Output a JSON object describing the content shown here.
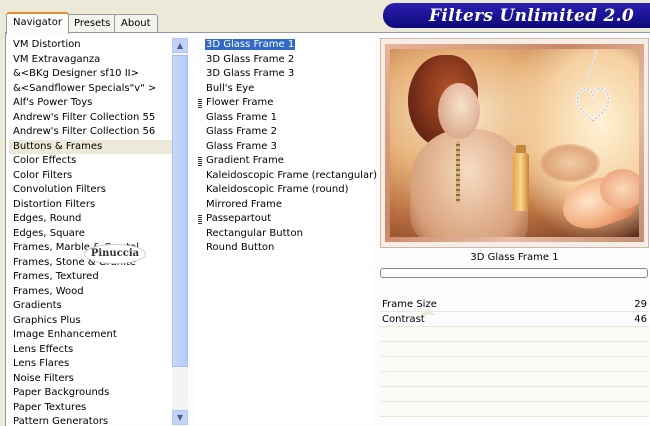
{
  "app_title": "Filters Unlimited 2.0",
  "tabs": [
    {
      "label": "Navigator",
      "active": true
    },
    {
      "label": "Presets",
      "active": false
    },
    {
      "label": "About",
      "active": false
    }
  ],
  "categories": [
    "VM Distortion",
    "VM Extravaganza",
    "&<BKg Designer sf10 II>",
    "&<Sandflower Specials\"v\" >",
    "Alf's Power Toys",
    "Andrew's Filter Collection 55",
    "Andrew's Filter Collection 56",
    "Buttons & Frames",
    "Color Effects",
    "Color Filters",
    "Convolution Filters",
    "Distortion Filters",
    "Edges, Round",
    "Edges, Square",
    "Frames, Marble & Crystal",
    "Frames, Stone & Granite",
    "Frames, Textured",
    "Frames, Wood",
    "Gradients",
    "Graphics Plus",
    "Image Enhancement",
    "Lens Effects",
    "Lens Flares",
    "Noise Filters",
    "Paper Backgrounds",
    "Paper Textures",
    "Pattern Generators"
  ],
  "selected_category": "Buttons & Frames",
  "filters": [
    {
      "label": "3D Glass Frame 1",
      "selected": true,
      "marked": false
    },
    {
      "label": "3D Glass Frame 2",
      "selected": false,
      "marked": false
    },
    {
      "label": "3D Glass Frame 3",
      "selected": false,
      "marked": false
    },
    {
      "label": "Bull's Eye",
      "selected": false,
      "marked": false
    },
    {
      "label": "Flower Frame",
      "selected": false,
      "marked": true
    },
    {
      "label": "Glass Frame 1",
      "selected": false,
      "marked": false
    },
    {
      "label": "Glass Frame 2",
      "selected": false,
      "marked": false
    },
    {
      "label": "Glass Frame 3",
      "selected": false,
      "marked": false
    },
    {
      "label": "Gradient Frame",
      "selected": false,
      "marked": true
    },
    {
      "label": "Kaleidoscopic Frame (rectangular)",
      "selected": false,
      "marked": false
    },
    {
      "label": "Kaleidoscopic Frame (round)",
      "selected": false,
      "marked": false
    },
    {
      "label": "Mirrored Frame",
      "selected": false,
      "marked": false
    },
    {
      "label": "Passepartout",
      "selected": false,
      "marked": true
    },
    {
      "label": "Rectangular Button",
      "selected": false,
      "marked": false
    },
    {
      "label": "Round Button",
      "selected": false,
      "marked": false
    }
  ],
  "preview_caption": "3D Glass Frame 1",
  "params": [
    {
      "label": "Frame Size",
      "value": "29"
    },
    {
      "label": "Contrast",
      "value": "46"
    }
  ],
  "watermark_text": "Pinuccia",
  "icons": {
    "scroll_up": "chevron-up-icon",
    "scroll_down": "chevron-down-icon",
    "preset_marker": "grip-marker-icon"
  },
  "colors": {
    "banner": "#1A14A0",
    "selection": "#316AC5",
    "tab_accent": "#E68B2C"
  }
}
